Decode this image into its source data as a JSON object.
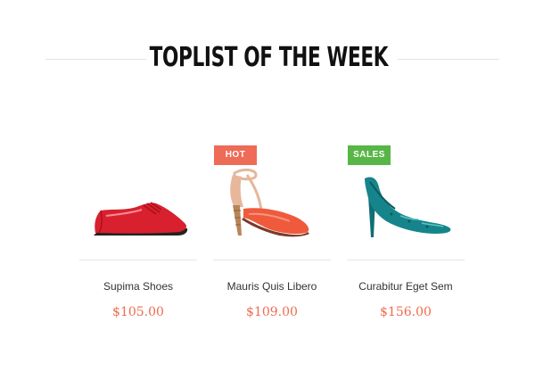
{
  "section": {
    "title": "TOPLIST OF THE WEEK"
  },
  "products": [
    {
      "name": "Supima Shoes",
      "price": "$105.00",
      "badge": "",
      "image_icon": "red-oxford-shoe-image",
      "colors": {
        "main": "#d8202e",
        "sole": "#222222"
      }
    },
    {
      "name": "Mauris Quis Libero",
      "price": "$109.00",
      "badge": "HOT",
      "image_icon": "ankle-strap-heel-image",
      "colors": {
        "main": "#ef5a3d",
        "accent": "#e6b79a",
        "heel": "#b98558"
      }
    },
    {
      "name": "Curabitur Eget Sem",
      "price": "$156.00",
      "badge": "SALES",
      "image_icon": "teal-pump-heel-image",
      "colors": {
        "main": "#16858b"
      }
    }
  ],
  "colors": {
    "price": "#ef6b4d",
    "badge_hot": "#ee6b57",
    "badge_sales": "#58b646"
  }
}
